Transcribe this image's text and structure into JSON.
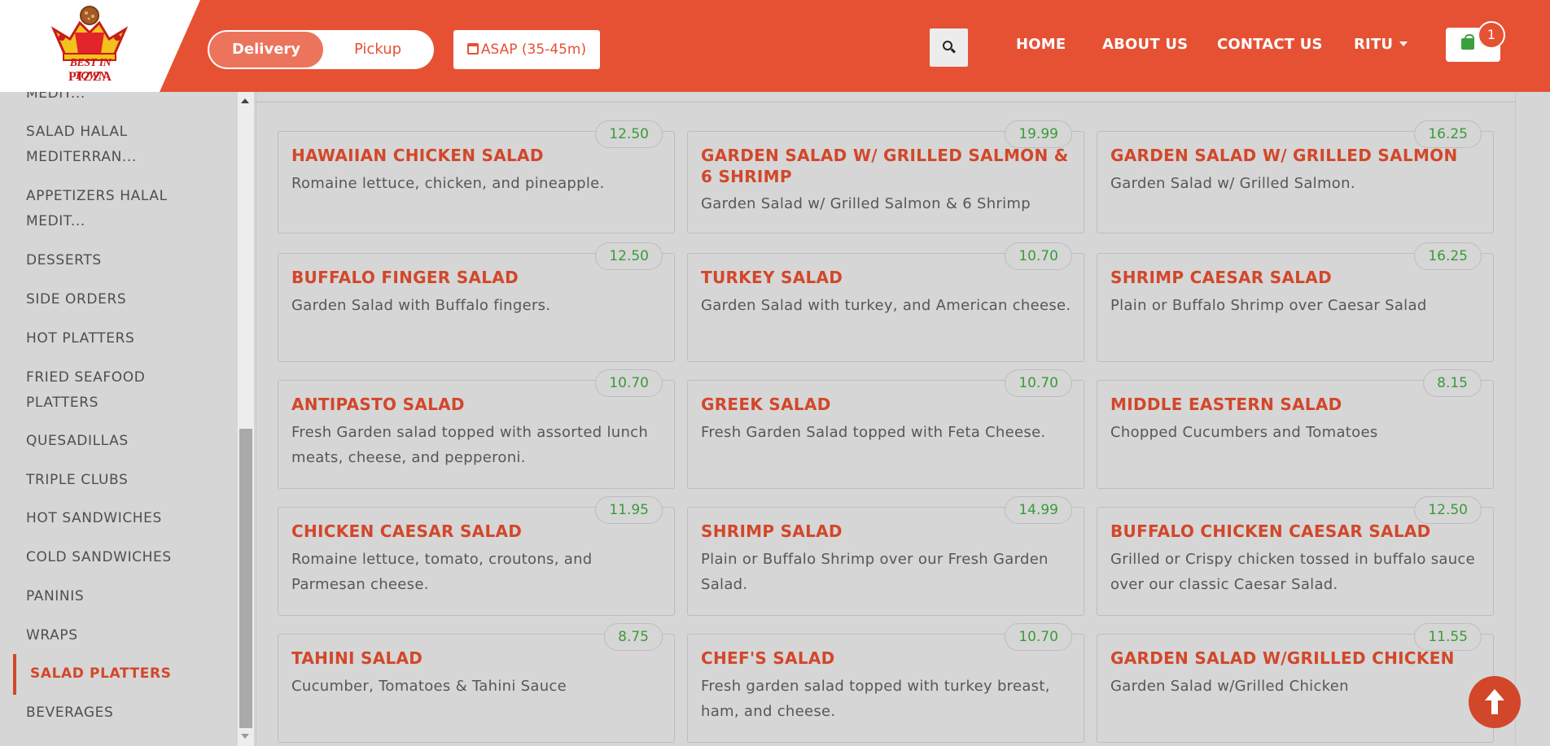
{
  "header": {
    "logo": {
      "line1": "BEST IN TOWN",
      "line2": "PIZZA"
    },
    "order_mode": {
      "delivery": "Delivery",
      "pickup": "Pickup",
      "selected": "Delivery"
    },
    "time_label": "ASAP (35-45m)",
    "nav": {
      "home": "HOME",
      "about": "ABOUT US",
      "contact": "CONTACT US",
      "user": "RITU"
    },
    "cart_count": "1"
  },
  "sidebar": {
    "items": [
      {
        "label": "MEDIT..."
      },
      {
        "label": "SALAD HALAL MEDITERRAN..."
      },
      {
        "label": "APPETIZERS HALAL MEDIT..."
      },
      {
        "label": "DESSERTS"
      },
      {
        "label": "SIDE ORDERS"
      },
      {
        "label": "HOT PLATTERS"
      },
      {
        "label": "FRIED SEAFOOD PLATTERS"
      },
      {
        "label": "QUESADILLAS"
      },
      {
        "label": "TRIPLE CLUBS"
      },
      {
        "label": "HOT SANDWICHES"
      },
      {
        "label": "COLD SANDWICHES"
      },
      {
        "label": "PANINIS"
      },
      {
        "label": "WRAPS"
      },
      {
        "label": "SALAD PLATTERS",
        "active": true
      },
      {
        "label": "BEVERAGES"
      }
    ]
  },
  "menu": [
    {
      "name": "HAWAIIAN CHICKEN SALAD",
      "desc": "Romaine lettuce, chicken, and pineapple.",
      "price": "12.50"
    },
    {
      "name": "GARDEN SALAD W/ GRILLED SALMON & 6 SHRIMP",
      "desc": "Garden Salad w/ Grilled Salmon & 6 Shrimp",
      "price": "19.99"
    },
    {
      "name": "GARDEN SALAD W/ GRILLED SALMON",
      "desc": "Garden Salad w/ Grilled Salmon.",
      "price": "16.25"
    },
    {
      "name": "BUFFALO FINGER SALAD",
      "desc": "Garden Salad with Buffalo fingers.",
      "price": "12.50"
    },
    {
      "name": "TURKEY SALAD",
      "desc": "Garden Salad with turkey, and American cheese.",
      "price": "10.70"
    },
    {
      "name": "SHRIMP CAESAR SALAD",
      "desc": "Plain or Buffalo Shrimp over Caesar Salad",
      "price": "16.25"
    },
    {
      "name": "ANTIPASTO SALAD",
      "desc": "Fresh Garden salad topped with assorted lunch meats, cheese, and pepperoni.",
      "price": "10.70"
    },
    {
      "name": "GREEK SALAD",
      "desc": "Fresh Garden Salad topped with Feta Cheese.",
      "price": "10.70"
    },
    {
      "name": "MIDDLE EASTERN SALAD",
      "desc": "Chopped Cucumbers and Tomatoes",
      "price": "8.15"
    },
    {
      "name": "CHICKEN CAESAR SALAD",
      "desc": "Romaine lettuce, tomato, croutons, and Parmesan cheese.",
      "price": "11.95"
    },
    {
      "name": "SHRIMP SALAD",
      "desc": "Plain or Buffalo Shrimp over our Fresh Garden Salad.",
      "price": "14.99"
    },
    {
      "name": "BUFFALO CHICKEN CAESAR SALAD",
      "desc": "Grilled or Crispy chicken tossed in buffalo sauce over our classic Caesar Salad.",
      "price": "12.50"
    },
    {
      "name": "TAHINI SALAD",
      "desc": "Cucumber, Tomatoes & Tahini Sauce",
      "price": "8.75"
    },
    {
      "name": "CHEF'S SALAD",
      "desc": "Fresh garden salad topped with turkey breast, ham, and cheese.",
      "price": "10.70"
    },
    {
      "name": "GARDEN SALAD W/GRILLED CHICKEN",
      "desc": "Garden Salad w/Grilled Chicken",
      "price": "11.55"
    }
  ],
  "colors": {
    "brand": "#e65134",
    "accent_text": "#d2472a",
    "price": "#3a9a3a"
  },
  "icons": {
    "search": "search-icon",
    "calendar": "calendar-icon",
    "cart": "cart-icon",
    "caret": "chevron-down-icon",
    "to_top": "arrow-up-icon"
  }
}
